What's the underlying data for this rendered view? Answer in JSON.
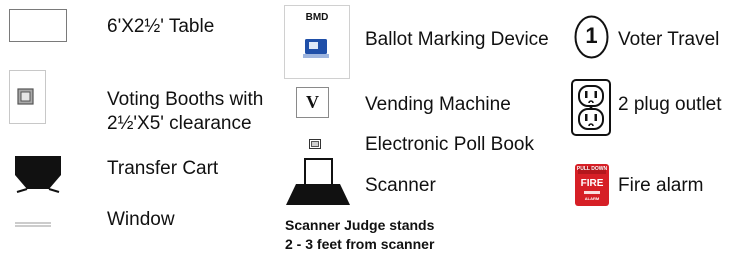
{
  "legend": {
    "items": [
      {
        "id": "table",
        "label": "6'X2½' Table",
        "icon": "table-rectangle-icon"
      },
      {
        "id": "voting-booths",
        "label_line1": "Voting Booths with",
        "label_line2": "2½'X5' clearance",
        "icon": "voting-booth-icon"
      },
      {
        "id": "transfer-cart",
        "label": "Transfer Cart",
        "icon": "transfer-cart-icon"
      },
      {
        "id": "window",
        "label": "Window",
        "icon": "window-icon"
      },
      {
        "id": "ballot-marking-device",
        "label": "Ballot Marking Device",
        "icon": "bmd-icon",
        "icon_caption": "BMD"
      },
      {
        "id": "vending-machine",
        "label": "Vending Machine",
        "icon": "vending-machine-icon",
        "icon_letter": "V"
      },
      {
        "id": "electronic-poll-book",
        "label": "Electronic Poll Book",
        "icon": "poll-book-icon"
      },
      {
        "id": "scanner",
        "label": "Scanner",
        "icon": "scanner-icon"
      },
      {
        "id": "voter-travel",
        "label": "Voter Travel",
        "icon": "voter-travel-circle-icon",
        "icon_number": "1"
      },
      {
        "id": "plug-outlet",
        "label": "2 plug outlet",
        "icon": "outlet-icon"
      },
      {
        "id": "fire-alarm",
        "label": "Fire alarm",
        "icon": "fire-alarm-icon",
        "icon_text_top": "PULL DOWN",
        "icon_text_main": "FIRE",
        "icon_text_bottom": "ALARM"
      }
    ],
    "scanner_note_line1": "Scanner Judge stands",
    "scanner_note_line2": "2 - 3 feet from scanner"
  },
  "colors": {
    "text": "#111111",
    "bmd_blue": "#1f4fa8",
    "fire_red": "#d61f26",
    "booth_gray": "#9a9a9a"
  }
}
